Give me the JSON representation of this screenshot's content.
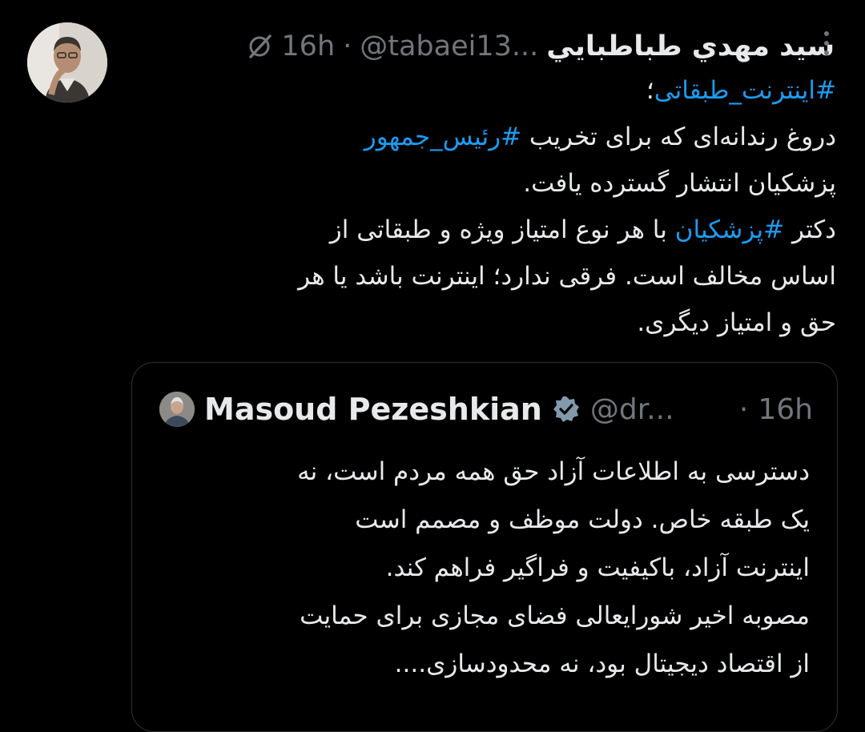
{
  "tweet": {
    "author_name": "سيد مهدي طباطبايي",
    "handle": "@tabaei13...",
    "separator": "·",
    "time": "16h",
    "lines": [
      {
        "parts": [
          {
            "text": "#اینترنت_طبقاتی",
            "hashtag": true
          },
          {
            "text": "؛",
            "hashtag": false
          }
        ]
      },
      {
        "parts": [
          {
            "text": "دروغ رندانه‌ای که برای تخریب ",
            "hashtag": false
          },
          {
            "text": "#رئیس_جمهور",
            "hashtag": true
          }
        ]
      },
      {
        "parts": [
          {
            "text": "پزشکیان انتشار گسترده یافت.",
            "hashtag": false
          }
        ]
      },
      {
        "parts": [
          {
            "text": "دکتر ",
            "hashtag": false
          },
          {
            "text": "#پزشکیان",
            "hashtag": true
          },
          {
            "text": " با هر نوع امتیاز ویژه و طبقاتی از",
            "hashtag": false
          }
        ]
      },
      {
        "parts": [
          {
            "text": "اساس مخالف است. فرقی ندارد؛ اینترنت باشد یا هر",
            "hashtag": false
          }
        ]
      },
      {
        "parts": [
          {
            "text": "حق و امتیاز دیگری.",
            "hashtag": false
          }
        ]
      }
    ]
  },
  "quote": {
    "author_name": "Masoud Pezeshkian",
    "handle": "@dr...",
    "separator": "·",
    "time": "16h",
    "lines": [
      "دسترسی به اطلاعات آزاد حق همه مردم است، نه",
      "یک طبقه خاص. دولت موظف و مصمم است",
      "اینترنت آزاد، باکیفیت و فراگیر فراهم کند.",
      "مصوبه اخیر شورایعالی فضای مجازی برای حمایت",
      "از اقتصاد دیجیتال بود، نه محدودسازی...."
    ]
  },
  "colors": {
    "background": "#000000",
    "text": "#e7e9ea",
    "secondary": "#71767b",
    "hashtag": "#1d9bf0",
    "border": "#2f3336",
    "verified": "#829aab"
  },
  "icons": [
    "grok-icon",
    "more-options-icon",
    "verified-badge-icon"
  ]
}
